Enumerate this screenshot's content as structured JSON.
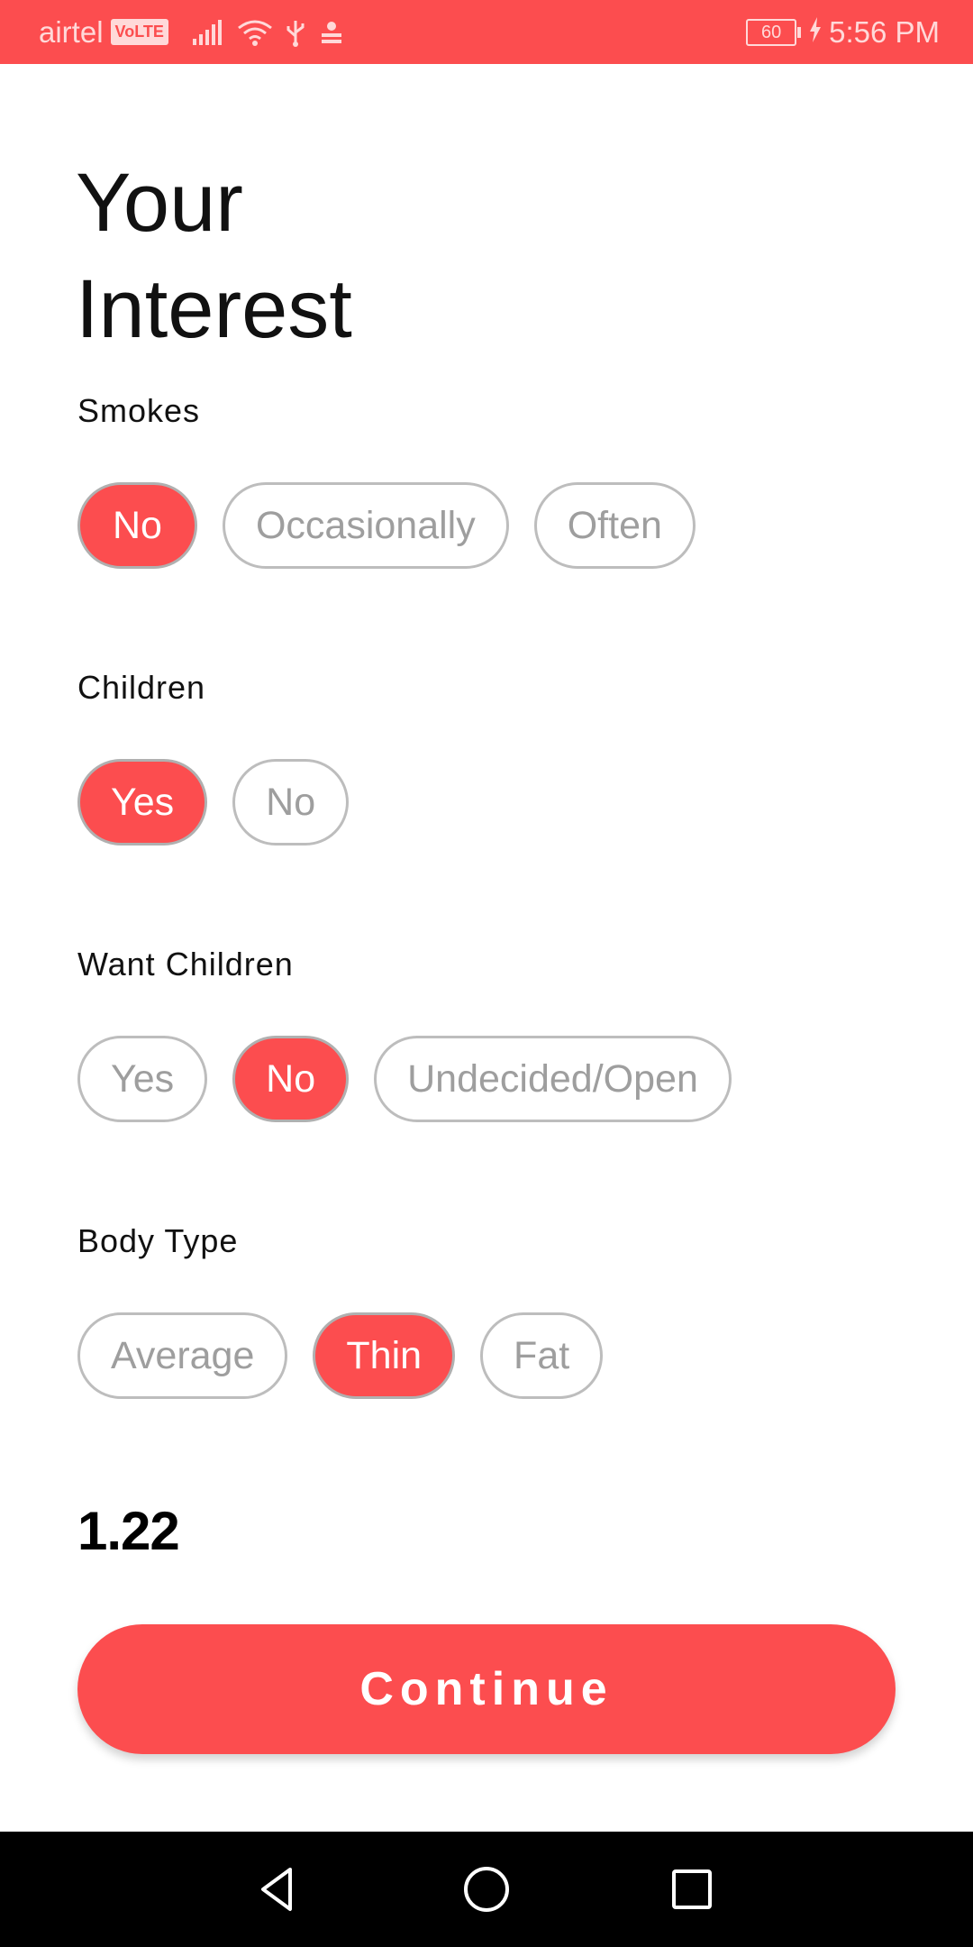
{
  "status_bar": {
    "carrier": "airtel",
    "network_badge": "VoLTE",
    "battery": "60",
    "time": "5:56 PM",
    "icons": [
      "signal-icon",
      "wifi-icon",
      "usb-icon",
      "notification-icon",
      "charging-icon"
    ]
  },
  "title": "Your\nInterest",
  "sections": {
    "smokes": {
      "label": "Smokes",
      "options": [
        "No",
        "Occasionally",
        "Often"
      ],
      "selected": "No"
    },
    "children": {
      "label": "Children",
      "options": [
        "Yes",
        "No"
      ],
      "selected": "Yes"
    },
    "want_children": {
      "label": "Want Children",
      "options": [
        "Yes",
        "No",
        "Undecided/Open"
      ],
      "selected": "No"
    },
    "body_type": {
      "label": "Body Type",
      "options": [
        "Average",
        "Thin",
        "Fat"
      ],
      "selected": "Thin"
    }
  },
  "value": "1.22",
  "continue_label": "Continue",
  "nav": {
    "icons": [
      "back-icon",
      "home-icon",
      "recents-icon"
    ]
  },
  "colors": {
    "accent": "#fc4d4f",
    "chip_border": "#bdbdbd",
    "chip_text": "#9e9e9e"
  }
}
